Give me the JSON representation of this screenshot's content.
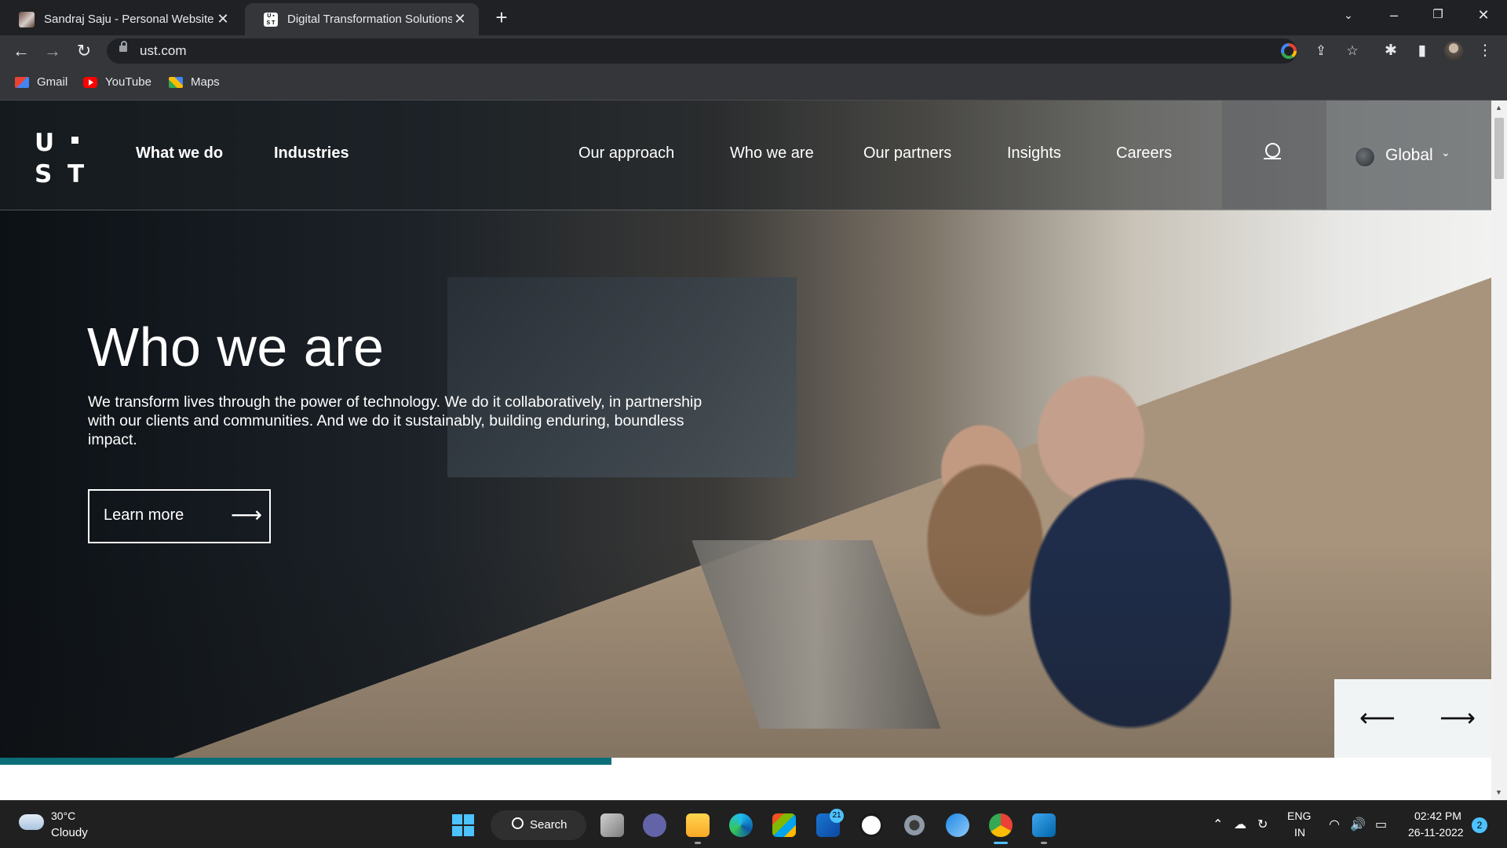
{
  "browser": {
    "tabs": [
      {
        "title": "Sandraj Saju - Personal Website",
        "active": false
      },
      {
        "title": "Digital Transformation Solutions",
        "active": true
      }
    ],
    "new_tab_icon": "plus-icon",
    "address": "ust.com",
    "bookmarks": [
      {
        "label": "Gmail",
        "icon": "gmail-icon"
      },
      {
        "label": "YouTube",
        "icon": "youtube-icon"
      },
      {
        "label": "Maps",
        "icon": "maps-icon"
      }
    ],
    "window_controls": [
      "minimize",
      "restore",
      "close"
    ]
  },
  "site": {
    "logo_letters": [
      "U",
      "S",
      "T"
    ],
    "nav_primary": [
      "What we do",
      "Industries"
    ],
    "nav_secondary": [
      "Our approach",
      "Who we are",
      "Our partners",
      "Insights",
      "Careers"
    ],
    "region": "Global",
    "hero": {
      "title": "Who we are",
      "text": "We transform lives through the power of technology.  We do it collaboratively, in partnership with our clients and communities. And we do it sustainably, building enduring, boundless impact.",
      "cta": "Learn more"
    },
    "slider_progress": 0.41,
    "accent_color": "#0b6e78"
  },
  "taskbar": {
    "weather": {
      "temp": "30°C",
      "condition": "Cloudy"
    },
    "search_label": "Search",
    "mail_badge": "21",
    "language": {
      "line1": "ENG",
      "line2": "IN"
    },
    "time": "02:42 PM",
    "date": "26-11-2022",
    "notifications": "2"
  }
}
